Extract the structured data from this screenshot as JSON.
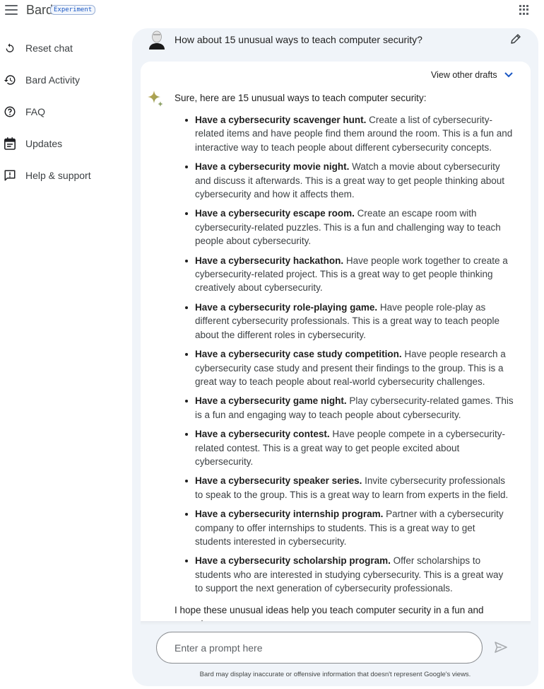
{
  "app": {
    "title": "Bard",
    "badge": "Experiment"
  },
  "sidebar": {
    "items": [
      {
        "label": "Reset chat",
        "icon": "reset-icon"
      },
      {
        "label": "Bard Activity",
        "icon": "history-icon"
      },
      {
        "label": "FAQ",
        "icon": "help-circle-icon"
      },
      {
        "label": "Updates",
        "icon": "calendar-icon"
      },
      {
        "label": "Help & support",
        "icon": "feedback-icon"
      }
    ]
  },
  "chat": {
    "user_prompt": "How about 15 unusual ways to teach computer security?",
    "view_drafts_label": "View other drafts",
    "intro": "Sure, here are 15 unusual ways to teach computer security:",
    "items": [
      {
        "title": "Have a cybersecurity scavenger hunt.",
        "text": " Create a list of cybersecurity-related items and have people find them around the room. This is a fun and interactive way to teach people about different cybersecurity concepts."
      },
      {
        "title": "Have a cybersecurity movie night.",
        "text": " Watch a movie about cybersecurity and discuss it afterwards. This is a great way to get people thinking about cybersecurity and how it affects them."
      },
      {
        "title": "Have a cybersecurity escape room.",
        "text": " Create an escape room with cybersecurity-related puzzles. This is a fun and challenging way to teach people about cybersecurity."
      },
      {
        "title": "Have a cybersecurity hackathon.",
        "text": " Have people work together to create a cybersecurity-related project. This is a great way to get people thinking creatively about cybersecurity."
      },
      {
        "title": "Have a cybersecurity role-playing game.",
        "text": " Have people role-play as different cybersecurity professionals. This is a great way to teach people about the different roles in cybersecurity."
      },
      {
        "title": "Have a cybersecurity case study competition.",
        "text": " Have people research a cybersecurity case study and present their findings to the group. This is a great way to teach people about real-world cybersecurity challenges."
      },
      {
        "title": "Have a cybersecurity game night.",
        "text": " Play cybersecurity-related games. This is a fun and engaging way to teach people about cybersecurity."
      },
      {
        "title": "Have a cybersecurity contest.",
        "text": " Have people compete in a cybersecurity-related contest. This is a great way to get people excited about cybersecurity."
      },
      {
        "title": "Have a cybersecurity speaker series.",
        "text": " Invite cybersecurity professionals to speak to the group. This is a great way to learn from experts in the field."
      },
      {
        "title": "Have a cybersecurity internship program.",
        "text": " Partner with a cybersecurity company to offer internships to students. This is a great way to get students interested in cybersecurity."
      },
      {
        "title": "Have a cybersecurity scholarship program.",
        "text": " Offer scholarships to students who are interested in studying cybersecurity. This is a great way to support the next generation of cybersecurity professionals."
      }
    ],
    "outro": "I hope these unusual ideas help you teach computer security in a fun and engaging way."
  },
  "input": {
    "placeholder": "Enter a prompt here",
    "value": ""
  },
  "footer": {
    "disclaimer": "Bard may display inaccurate or offensive information that doesn't represent Google's views."
  },
  "colors": {
    "panel_bg": "#f0f4f9",
    "badge_blue": "#1a57c4",
    "link_blue": "#1a57c4"
  }
}
